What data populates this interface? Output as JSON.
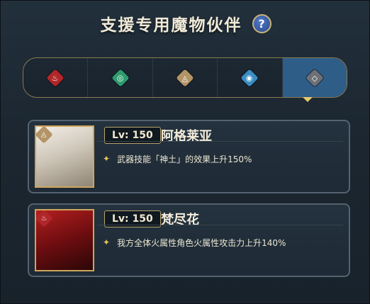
{
  "header": {
    "title": "支援专用魔物伙伴",
    "help_label": "?"
  },
  "tabs": [
    {
      "element": "fire",
      "glyph": "♨",
      "color": "#b0262a",
      "active": false
    },
    {
      "element": "wind",
      "glyph": "◎",
      "color": "#2e9b6e",
      "active": false
    },
    {
      "element": "earth",
      "glyph": "◬",
      "color": "#b39466",
      "active": false
    },
    {
      "element": "water",
      "glyph": "◉",
      "color": "#3a8ec4",
      "active": false
    },
    {
      "element": "light",
      "glyph": "◇",
      "color": "#6d7076",
      "active": true
    }
  ],
  "partners": [
    {
      "level": "Lv: 150",
      "name": "阿格莱亚",
      "element": "earth",
      "skill_bullet": "✦",
      "skill": "武器技能「神土」的效果上升150%"
    },
    {
      "level": "Lv: 150",
      "name": "梵尽花",
      "element": "fire",
      "skill_bullet": "✦",
      "skill": "我方全体火属性角色火属性攻击力上升140%"
    }
  ],
  "colors": {
    "accent_gold": "#cfa55a",
    "active_tab": "#2e5d88"
  }
}
